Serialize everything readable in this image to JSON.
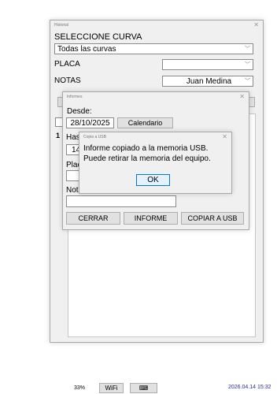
{
  "historial": {
    "title": "Historial",
    "curva_label": "SELECCIONE CURVA",
    "curva_value": "Todas las curvas",
    "placa_label": "PLACA",
    "placa_value": "",
    "notas_label": "NOTAS",
    "notas_value": "Juan Medina",
    "row_marker": "1"
  },
  "informes": {
    "title": "Informes",
    "desde_label": "Desde:",
    "desde_value": "28/10/2025",
    "calendario_label": "Calendario",
    "hasta_label": "Has",
    "hasta_value": "14",
    "placa_label": "Plac",
    "notas_label": "Nota",
    "cerrar_label": "CERRAR",
    "informe_label": "INFORME",
    "copiar_label": "COPIAR A USB"
  },
  "dialog": {
    "title": "Copia a USB",
    "message_line1": "Informe copiado a la memoria USB.",
    "message_line2": "Puede retirar la memoria del equipo.",
    "ok_label": "OK"
  },
  "taskbar": {
    "battery": "33%",
    "wifi": "WiFi",
    "keyboard_icon": "keyboard-icon",
    "datetime": "2026.04.14 15:32"
  }
}
